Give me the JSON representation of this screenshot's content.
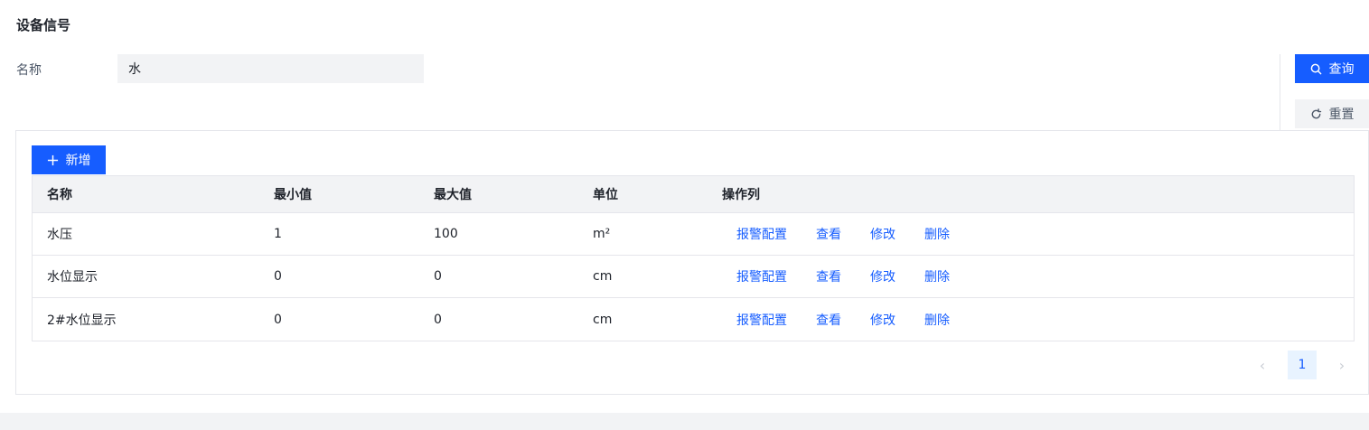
{
  "page": {
    "title": "设备信号"
  },
  "filter": {
    "name_label": "名称",
    "name_value": "水"
  },
  "actions": {
    "query_label": "查询",
    "reset_label": "重置",
    "add_label": "新增"
  },
  "table": {
    "headers": {
      "name": "名称",
      "min": "最小值",
      "max": "最大值",
      "unit": "单位",
      "ops": "操作列"
    },
    "rows": [
      {
        "name": "水压",
        "min": "1",
        "max": "100",
        "unit": "m²"
      },
      {
        "name": "水位显示",
        "min": "0",
        "max": "0",
        "unit": "cm"
      },
      {
        "name": "2#水位显示",
        "min": "0",
        "max": "0",
        "unit": "cm"
      }
    ],
    "row_actions": {
      "alarm": "报警配置",
      "view": "查看",
      "edit": "修改",
      "delete": "删除"
    }
  },
  "pagination": {
    "current": "1",
    "prev": "‹",
    "next": "›"
  },
  "colors": {
    "primary": "#165dff",
    "muted_bg": "#f2f3f5"
  }
}
